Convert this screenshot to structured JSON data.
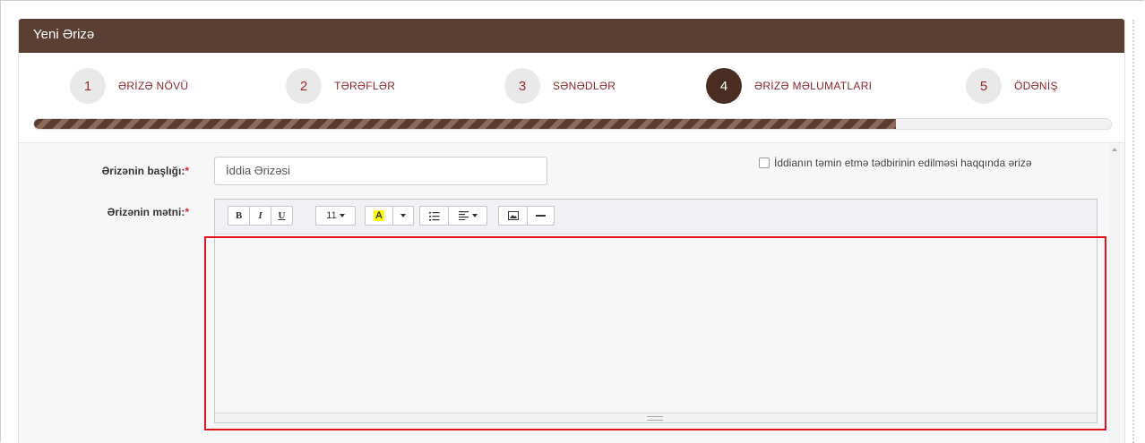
{
  "panel": {
    "title": "Yeni Ərizə"
  },
  "steps": [
    {
      "num": "1",
      "label": "ƏRİZƏ NÖVÜ",
      "active": false
    },
    {
      "num": "2",
      "label": "TƏRƏFLƏR",
      "active": false
    },
    {
      "num": "3",
      "label": "SƏNƏDLƏR",
      "active": false
    },
    {
      "num": "4",
      "label": "ƏRİZƏ MƏLUMATLARI",
      "active": true
    },
    {
      "num": "5",
      "label": "ÖDƏNİŞ",
      "active": false
    }
  ],
  "progress": {
    "fraction": 0.8
  },
  "form": {
    "title_label": "Ərizənin başlığı:",
    "title_value": "İddia Ərizəsi",
    "text_label": "Ərizənin mətni:",
    "required_mark": "*",
    "checkbox_label": "İddianın təmin etmə tədbirinin edilməsi haqqında ərizə",
    "checkbox_checked": false
  },
  "toolbar": {
    "bold": "B",
    "italic": "I",
    "underline": "U",
    "font_size": "11",
    "color_letter": "A",
    "icons": [
      "bold-icon",
      "italic-icon",
      "underline-icon",
      "font-size-dropdown",
      "text-color-icon",
      "list-icon",
      "align-icon",
      "image-icon",
      "horizontal-rule-icon"
    ]
  },
  "colors": {
    "header": "#5b3f32",
    "active_step": "#4a2d22",
    "step_text": "#8b2424",
    "highlight": "#e3121f"
  }
}
